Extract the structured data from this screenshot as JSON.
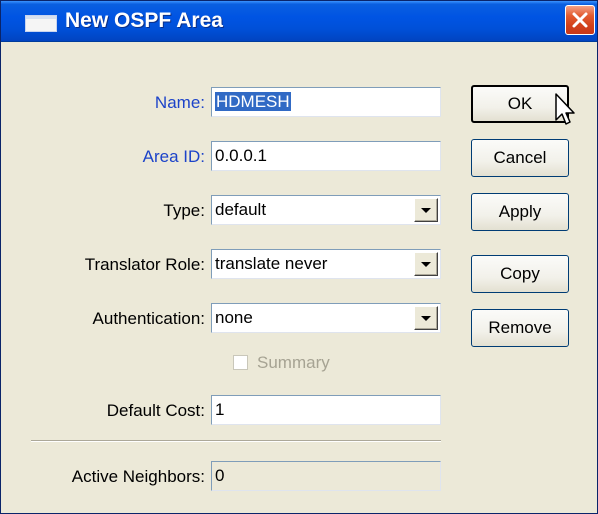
{
  "window": {
    "title": "New OSPF Area"
  },
  "form": {
    "name": {
      "label": "Name:",
      "value": "HDMESH"
    },
    "area_id": {
      "label": "Area ID:",
      "value": "0.0.0.1"
    },
    "type": {
      "label": "Type:",
      "value": "default"
    },
    "translator_role": {
      "label": "Translator Role:",
      "value": "translate never"
    },
    "authentication": {
      "label": "Authentication:",
      "value": "none"
    },
    "summary": {
      "label": "Summary",
      "checked": false,
      "enabled": false
    },
    "default_cost": {
      "label": "Default Cost:",
      "value": "1"
    },
    "active_neighbors": {
      "label": "Active Neighbors:",
      "value": "0"
    }
  },
  "buttons": {
    "ok": "OK",
    "cancel": "Cancel",
    "apply": "Apply",
    "copy": "Copy",
    "remove": "Remove"
  },
  "icons": {
    "window_icon": "window-icon",
    "close": "close-icon",
    "dropdown": "chevron-down-icon",
    "cursor": "mouse-pointer-icon"
  },
  "colors": {
    "titlebar": "#0054e3",
    "dialog_bg": "#ece9d8",
    "label_blue": "#1c43c9",
    "selection": "#316ac5",
    "close_button": "#d2401a"
  }
}
